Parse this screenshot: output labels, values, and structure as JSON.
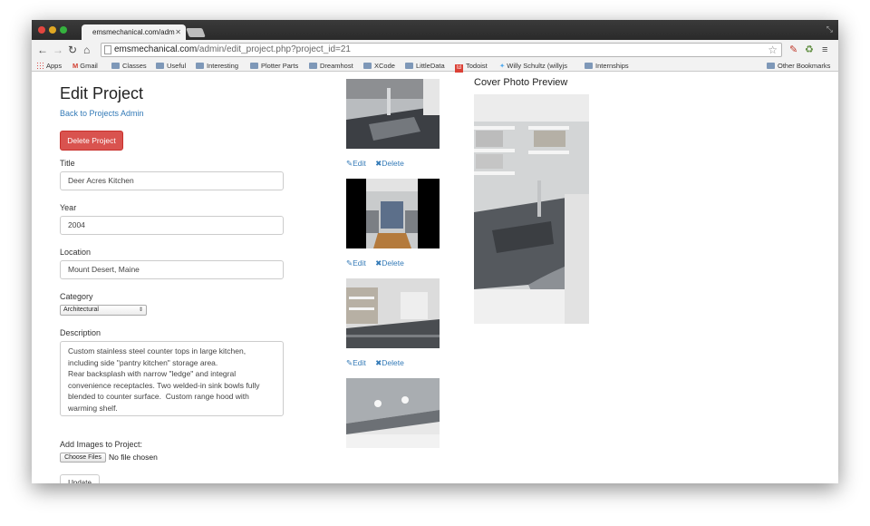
{
  "browser": {
    "tab_title": "emsmechanical.com/adm",
    "url_host": "emsmechanical.com",
    "url_path": "/admin/edit_project.php?project_id=21",
    "bookmarks": [
      "Apps",
      "Gmail",
      "Classes",
      "Useful",
      "Interesting",
      "Plotter Parts",
      "Dreamhost",
      "XCode",
      "LittleData",
      "Todoist",
      "Willy Schultz (willyjs",
      "Internships"
    ],
    "other_bookmarks": "Other Bookmarks"
  },
  "page": {
    "title": "Edit Project",
    "back_link": "Back to Projects Admin",
    "delete_project": "Delete Project"
  },
  "form": {
    "title_label": "Title",
    "title_value": "Deer Acres Kitchen",
    "year_label": "Year",
    "year_value": "2004",
    "location_label": "Location",
    "location_value": "Mount Desert, Maine",
    "category_label": "Category",
    "category_value": "Architectural",
    "description_label": "Description",
    "description_value": "Custom stainless steel counter tops in large kitchen,\nincluding side \"pantry kitchen\" storage area.\nRear backsplash with narrow \"ledge\" and integral\nconvenience receptacles. Two welded-in sink bowls fully\nblended to counter surface.  Custom range hood with\nwarming shelf.",
    "add_images_label": "Add Images to Project:",
    "choose_files": "Choose Files",
    "no_file": "No file chosen",
    "update": "Update"
  },
  "gallery": {
    "edit": "Edit",
    "delete": "Delete"
  },
  "cover": {
    "heading": "Cover Photo Preview"
  },
  "colors": {
    "link": "#337ab7",
    "danger": "#d9534f"
  }
}
